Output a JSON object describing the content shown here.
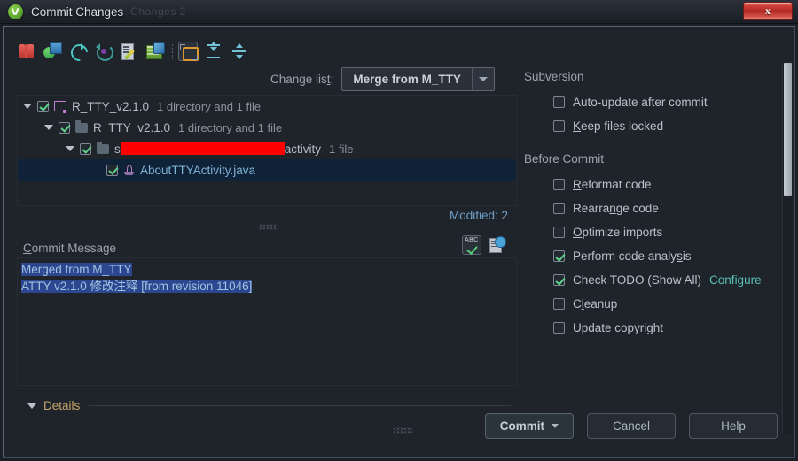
{
  "window": {
    "title": "Commit Changes",
    "ghost_title": "Changes 2",
    "app_icon": "android-studio-icon",
    "close_label": "x"
  },
  "toolbar": {
    "icons": [
      {
        "name": "show-diff-icon",
        "title": "Show Diff"
      },
      {
        "name": "move-to-changelist-icon",
        "title": "Move to Another Changelist"
      },
      {
        "name": "refresh-icon",
        "title": "Refresh Changes"
      },
      {
        "name": "revert-icon",
        "title": "Revert"
      },
      {
        "name": "edit-source-icon",
        "title": "Edit Source"
      },
      {
        "name": "update-directory-icon",
        "title": "Update Directory"
      },
      {
        "name": "group-by-directory-icon",
        "title": "Group by Directory"
      },
      {
        "name": "expand-all-icon",
        "title": "Expand All"
      },
      {
        "name": "collapse-all-icon",
        "title": "Collapse All"
      }
    ]
  },
  "changelist": {
    "label_pre": "Change lis",
    "label_mnemonic": "t",
    "label_post": ":",
    "selected": "Merge from M_TTY",
    "arrow_icon": "chevron-down-icon"
  },
  "tree": {
    "rows": [
      {
        "indent": 0,
        "expander": "triangle-down-icon",
        "checked": true,
        "icon": "changelist-icon",
        "name": "R_TTY_v2.1.0",
        "meta": "1 directory and 1 file",
        "selected": false,
        "redacted": false
      },
      {
        "indent": 1,
        "expander": "triangle-down-icon",
        "checked": true,
        "icon": "folder-icon",
        "name": "R_TTY_v2.1.0",
        "meta": "1 directory and 1 file",
        "selected": false,
        "redacted": false
      },
      {
        "indent": 2,
        "expander": "triangle-down-icon",
        "checked": true,
        "icon": "folder-icon",
        "name_prefix": "s",
        "redacted": true,
        "redact_width": 185,
        "name_suffix": "activity",
        "meta": "1 file",
        "selected": false
      },
      {
        "indent": 3,
        "expander": "none",
        "checked": true,
        "icon": "java-file-icon",
        "name": "AboutTTYActivity.java",
        "meta": "",
        "selected": true,
        "redacted": false,
        "is_file": true
      }
    ],
    "modified_count": "Modified: 2"
  },
  "commit_message": {
    "label_mnemonic": "C",
    "label_rest": "ommit Message",
    "lines": [
      "Merged from M_TTY",
      "ATTY v2.1.0 修改注释 [from revision 11046]"
    ],
    "spellcheck_icon": "spellcheck-icon",
    "history_icon": "commit-history-icon"
  },
  "details": {
    "label": "Details",
    "expander": "triangle-down-icon"
  },
  "options": {
    "groups": [
      {
        "title": "Subversion",
        "items": [
          {
            "label": "Auto-update after commit",
            "checked": false,
            "mnemonic": "",
            "link": ""
          },
          {
            "label": "Keep files locked",
            "checked": false,
            "mnemonic": "K",
            "link": ""
          }
        ]
      },
      {
        "title": "Before Commit",
        "items": [
          {
            "label": "Reformat code",
            "checked": false,
            "mnemonic": "R",
            "link": ""
          },
          {
            "label": "Rearrange code",
            "checked": false,
            "mnemonic": "n",
            "link": ""
          },
          {
            "label": "Optimize imports",
            "checked": false,
            "mnemonic": "O",
            "link": ""
          },
          {
            "label": "Perform code analysis",
            "checked": true,
            "mnemonic": "s",
            "link": ""
          },
          {
            "label": "Check TODO (Show All)",
            "checked": true,
            "mnemonic": "",
            "link": "Configure"
          },
          {
            "label": "Cleanup",
            "checked": false,
            "mnemonic": "l",
            "link": ""
          },
          {
            "label": "Update copyright",
            "checked": false,
            "mnemonic": "",
            "link": ""
          }
        ]
      }
    ]
  },
  "buttons": {
    "commit": "Commit",
    "cancel": "Cancel",
    "help": "Help"
  },
  "colors": {
    "accent_link": "#59bfb3",
    "check_green": "#5fd18a",
    "selection_blue": "#2c4790",
    "redact_red": "#ff0000",
    "details_amber": "#c3a46a"
  }
}
